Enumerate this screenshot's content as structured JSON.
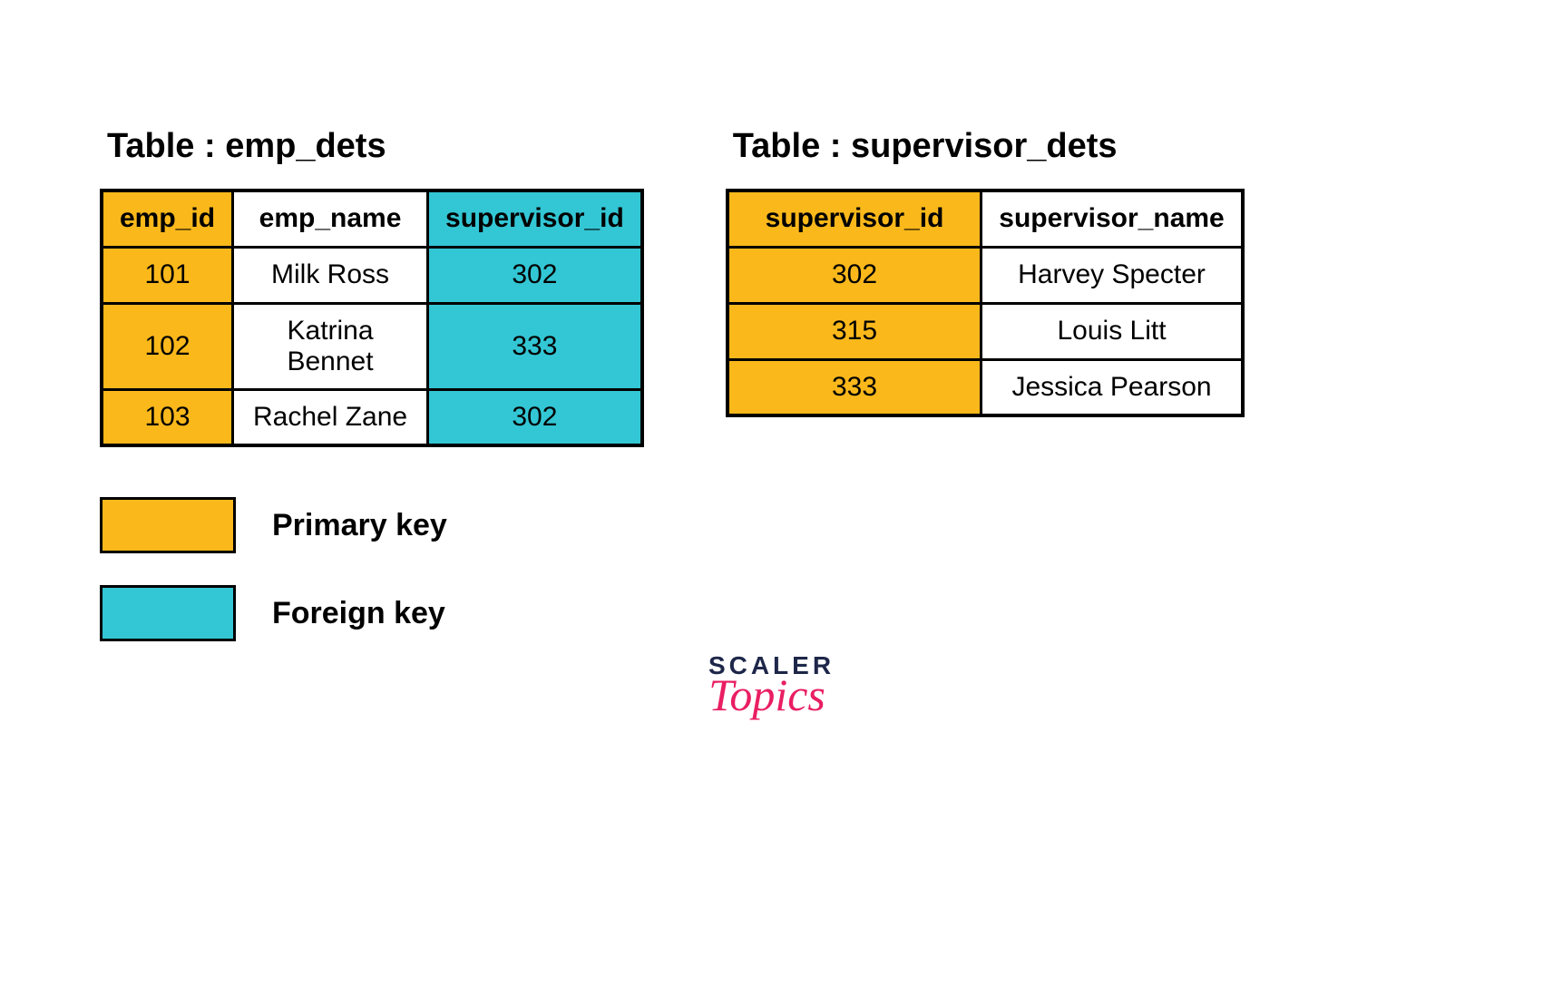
{
  "tables": {
    "emp": {
      "title": "Table : emp_dets",
      "headers": [
        "emp_id",
        "emp_name",
        "supervisor_id"
      ],
      "rows": [
        {
          "emp_id": "101",
          "emp_name": "Milk Ross",
          "supervisor_id": "302"
        },
        {
          "emp_id": "102",
          "emp_name": "Katrina Bennet",
          "supervisor_id": "333"
        },
        {
          "emp_id": "103",
          "emp_name": "Rachel Zane",
          "supervisor_id": "302"
        }
      ]
    },
    "sup": {
      "title": "Table : supervisor_dets",
      "headers": [
        "supervisor_id",
        "supervisor_name"
      ],
      "rows": [
        {
          "supervisor_id": "302",
          "supervisor_name": "Harvey Specter"
        },
        {
          "supervisor_id": "315",
          "supervisor_name": "Louis Litt"
        },
        {
          "supervisor_id": "333",
          "supervisor_name": "Jessica Pearson"
        }
      ]
    }
  },
  "legend": {
    "primary": {
      "label": "Primary key",
      "color": "#fab81b"
    },
    "foreign": {
      "label": "Foreign key",
      "color": "#33c6d4"
    }
  },
  "brand": {
    "line1": "SCALER",
    "line2": "Topics"
  }
}
